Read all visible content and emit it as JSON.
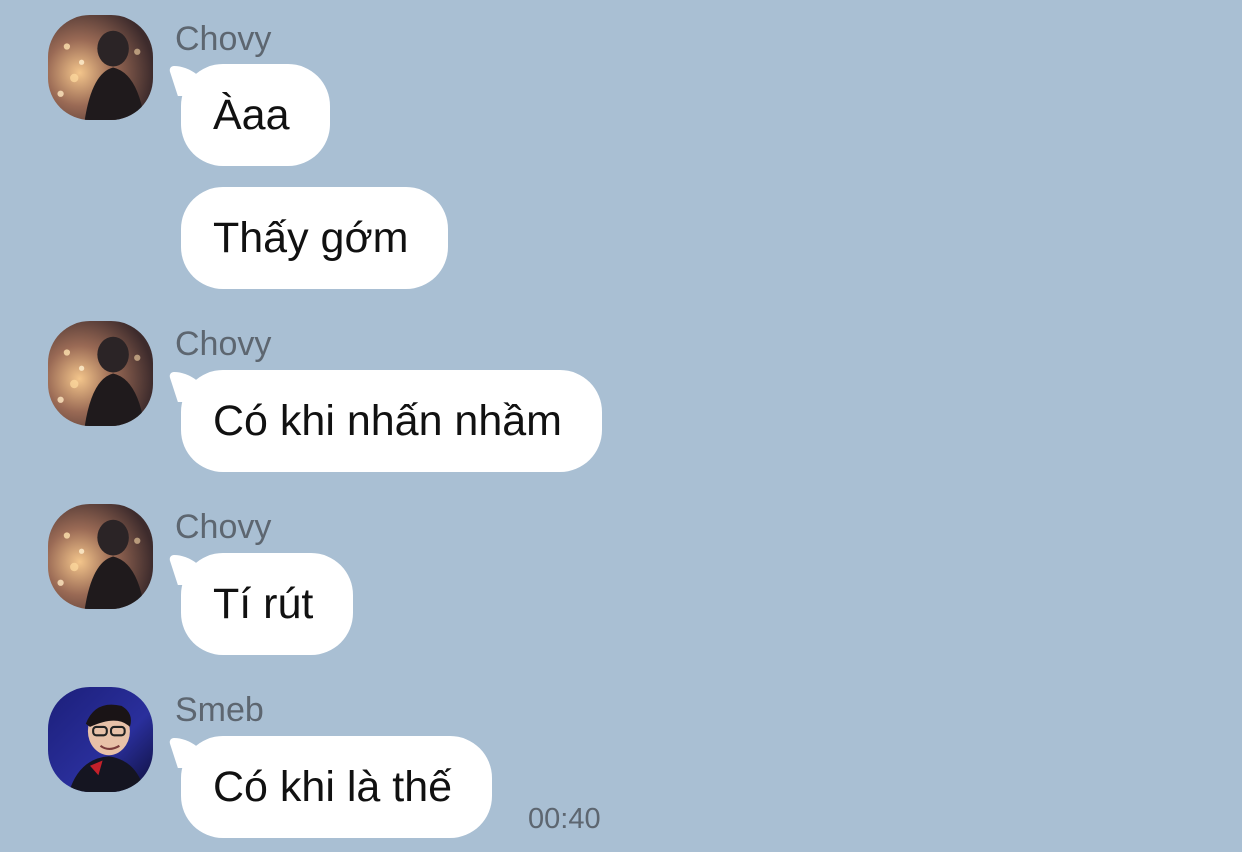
{
  "messages": [
    {
      "sender": "Chovy",
      "avatar": "chovy-avatar",
      "bubbles": [
        "Àaa",
        "Thấy gớm"
      ]
    },
    {
      "sender": "Chovy",
      "avatar": "chovy-avatar",
      "bubbles": [
        "Có khi nhấn nhầm"
      ]
    },
    {
      "sender": "Chovy",
      "avatar": "chovy-avatar",
      "bubbles": [
        "Tí rút"
      ]
    },
    {
      "sender": "Smeb",
      "avatar": "smeb-avatar",
      "bubbles": [
        "Có khi là thế"
      ],
      "time": "00:40"
    }
  ],
  "colors": {
    "background": "#a9bfd3",
    "bubble": "#ffffff",
    "meta_text": "#5d6670"
  }
}
